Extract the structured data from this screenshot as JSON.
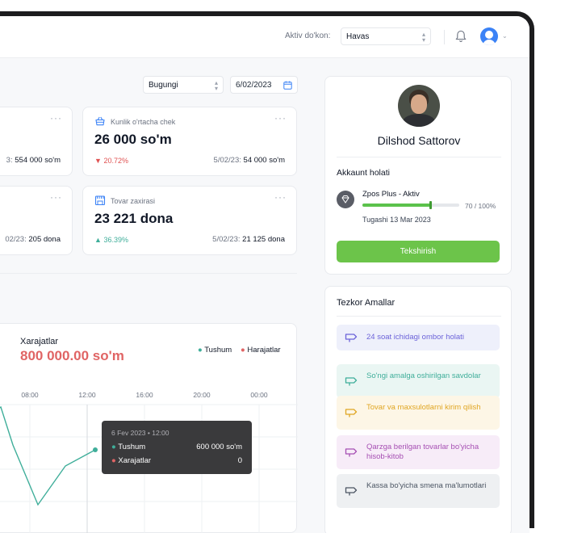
{
  "header": {
    "shop_label": "Aktiv do'kon:",
    "shop_value": "Havas"
  },
  "filters": {
    "period": "Bugungi",
    "date": "6/02/2023"
  },
  "stats": {
    "left_top": {
      "cmp_prefix": "3:",
      "cmp_value": "554 000 so'm"
    },
    "left_bottom": {
      "cmp_prefix": "02/23:",
      "cmp_value": "205 dona"
    },
    "avg_check": {
      "title": "Kunlik o'rtacha chek",
      "value": "26 000 so'm",
      "delta": "20.72%",
      "cmp_prefix": "5/02/23:",
      "cmp_value": "54 000 so'm"
    },
    "stock": {
      "title": "Tovar zaxirasi",
      "value": "23 221 dona",
      "delta": "36.39%",
      "cmp_prefix": "5/02/23:",
      "cmp_value": "21 125 dona"
    }
  },
  "chart": {
    "title": "Xarajatlar",
    "total": "800 000.00 so'm",
    "legend": [
      "Tushum",
      "Harajatlar"
    ],
    "tooltip": {
      "date": "6 Fev 2023 • 12:00",
      "income_label": "Tushum",
      "income_value": "600 000 so'm",
      "expense_label": "Xarajatlar",
      "expense_value": "0"
    }
  },
  "chart_data": {
    "type": "line",
    "x": [
      "08:00",
      "12:00",
      "16:00",
      "20:00",
      "00:00"
    ],
    "series": [
      {
        "name": "Tushum",
        "color": "#3fae9a"
      }
    ],
    "tooltip_point": {
      "x": "12:00",
      "Tushum": 600000,
      "Xarajatlar": 0
    }
  },
  "profile": {
    "name": "Dilshod Sattorov",
    "status_title": "Akkaunt holati",
    "plan": "Zpos Plus - Aktiv",
    "progress_label": "70 / 100%",
    "progress": 0.7,
    "expiry": "Tugashi 13 Mar 2023",
    "check_button": "Tekshirish"
  },
  "quick": {
    "title": "Tezkor Amallar",
    "items": [
      {
        "label": "24 soat ichidagi ombor holati",
        "color": "#6c63d9",
        "bg": "#eef0fb"
      },
      {
        "label": "So'ngi amalga oshirilgan savdolar",
        "color": "#3fae9a",
        "bg": "#eaf6f3"
      },
      {
        "label": "Tovar va maxsulotlarni kirim qilish",
        "color": "#e0a623",
        "bg": "#fdf6e6"
      },
      {
        "label": "Qarzga berilgan tovarlar bo'yicha hisob-kitob",
        "color": "#a64fb3",
        "bg": "#f7ecf8"
      },
      {
        "label": "Kassa bo'yicha smena ma'lumotlari",
        "color": "#4b5563",
        "bg": "#eef0f2"
      }
    ]
  }
}
